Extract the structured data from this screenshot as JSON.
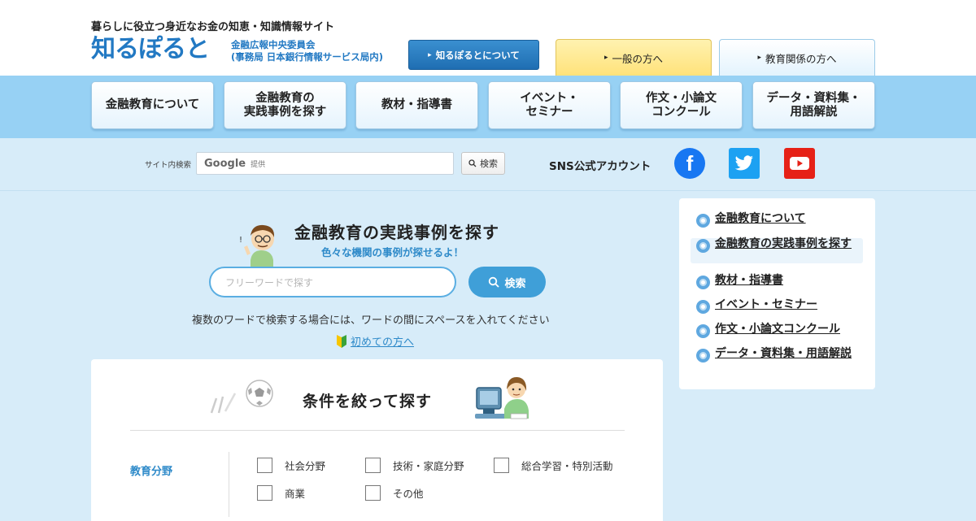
{
  "header": {
    "tagline": "暮らしに役立つ身近なお金の知恵・知識情報サイト",
    "logo_text_1": "知",
    "logo_text_2": "るぽると",
    "org_line1": "金融広報中央委員会",
    "org_line2": "(事務局 日本銀行情報サービス局内)",
    "about_button": "知るぽるとについて",
    "tab_general": "一般の方へ",
    "tab_education": "教育関係の方へ"
  },
  "nav": {
    "items": [
      "金融教育について",
      "金融教育の\n実践事例を探す",
      "教材・指導書",
      "イベント・\nセミナー",
      "作文・小論文\nコンクール",
      "データ・資料集・\n用語解説"
    ]
  },
  "search_bar": {
    "label": "サイト内検索",
    "brand": "Google",
    "provided": "提供",
    "button": "検索",
    "sns_label": "SNS公式アカウント",
    "sns_icons": [
      "facebook-icon",
      "twitter-icon",
      "youtube-icon"
    ]
  },
  "main": {
    "title": "金融教育の実践事例を探す",
    "subtitle": "色々な機関の事例が探せるよ！",
    "placeholder": "フリーワードで探す",
    "search_button": "検索",
    "hint": "複数のワードで検索する場合には、ワードの間にスペースを入れてください",
    "first_time_link": "初めての方へ"
  },
  "filters": {
    "title": "条件を絞って探す",
    "field_label": "教育分野",
    "options": [
      "社会分野",
      "技術・家庭分野",
      "総合学習・特別活動",
      "商業",
      "その他"
    ]
  },
  "sidebar": {
    "items": [
      "金融教育について",
      "金融教育の実践事例を探す",
      "教材・指導書",
      "イベント・セミナー",
      "作文・小論文コンクール",
      "データ・資料集・用語解説"
    ],
    "active_index": 1
  },
  "colors": {
    "brand_blue": "#2279c3",
    "accent_blue": "#3f9fd8",
    "nav_band": "#97d1f4",
    "page_bg": "#d7ecf9",
    "general_tab": "#ffe27a"
  }
}
